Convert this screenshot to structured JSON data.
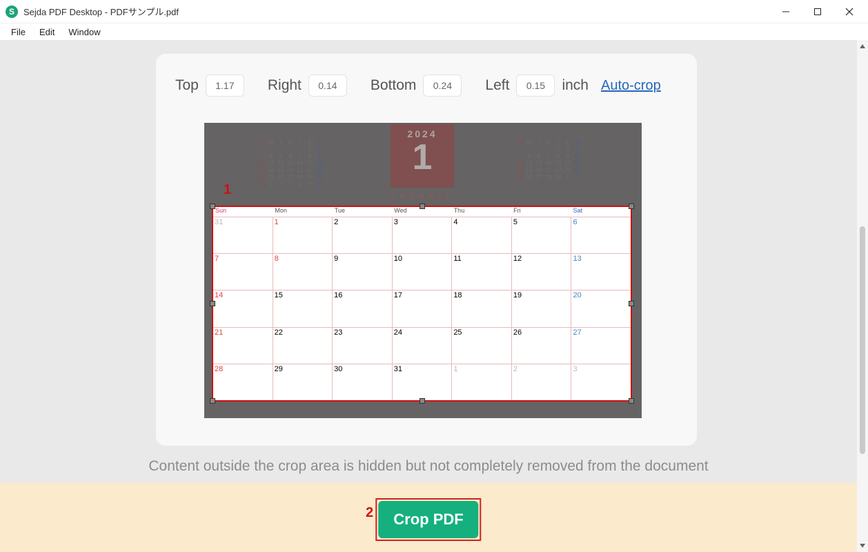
{
  "titlebar": {
    "app_title": "Sejda PDF Desktop - PDFサンプル.pdf"
  },
  "menubar": {
    "file": "File",
    "edit": "Edit",
    "window": "Window"
  },
  "controls": {
    "top_label": "Top",
    "top_value": "1.17",
    "right_label": "Right",
    "right_value": "0.14",
    "bottom_label": "Bottom",
    "bottom_value": "0.24",
    "left_label": "Left",
    "left_value": "0.15",
    "unit_label": "inch",
    "autocrop_label": "Auto-crop"
  },
  "preview": {
    "big_year": "2024",
    "big_month_num": "1",
    "big_month_name": "January",
    "mini_prev": {
      "title": "12",
      "dow": [
        "S",
        "M",
        "T",
        "W",
        "T",
        "F",
        "S"
      ],
      "weeks": [
        [
          "",
          "",
          "",
          "",
          "",
          "1",
          "2"
        ],
        [
          "3",
          "4",
          "5",
          "6",
          "7",
          "8",
          "9"
        ],
        [
          "10",
          "11",
          "12",
          "13",
          "14",
          "15",
          "16"
        ],
        [
          "17",
          "18",
          "19",
          "20",
          "21",
          "22",
          "23"
        ],
        [
          "24",
          "25",
          "26",
          "27",
          "28",
          "29",
          "30"
        ],
        [
          "31",
          "1",
          "2",
          "3",
          "4",
          "5",
          "6"
        ]
      ]
    },
    "mini_next": {
      "title": "2",
      "dow": [
        "S",
        "M",
        "T",
        "W",
        "T",
        "F",
        "S"
      ],
      "weeks": [
        [
          "",
          "",
          "",
          "",
          "1",
          "2",
          "3"
        ],
        [
          "4",
          "5",
          "6",
          "7",
          "8",
          "9",
          "10"
        ],
        [
          "11",
          "12",
          "13",
          "14",
          "15",
          "16",
          "17"
        ],
        [
          "18",
          "19",
          "20",
          "21",
          "22",
          "23",
          "24"
        ],
        [
          "25",
          "26",
          "27",
          "28",
          "29",
          "1",
          "2"
        ]
      ]
    },
    "main_dow": [
      "Sun",
      "Mon",
      "Tue",
      "Wed",
      "Thu",
      "Fri",
      "Sat"
    ],
    "main_weeks": [
      [
        {
          "n": "31",
          "c": "gray"
        },
        {
          "n": "1",
          "c": "sun"
        },
        {
          "n": "2"
        },
        {
          "n": "3"
        },
        {
          "n": "4"
        },
        {
          "n": "5"
        },
        {
          "n": "6",
          "c": "sat"
        }
      ],
      [
        {
          "n": "7",
          "c": "sun"
        },
        {
          "n": "8",
          "c": "sun"
        },
        {
          "n": "9"
        },
        {
          "n": "10"
        },
        {
          "n": "11"
        },
        {
          "n": "12"
        },
        {
          "n": "13",
          "c": "sat"
        }
      ],
      [
        {
          "n": "14",
          "c": "sun"
        },
        {
          "n": "15"
        },
        {
          "n": "16"
        },
        {
          "n": "17"
        },
        {
          "n": "18"
        },
        {
          "n": "19"
        },
        {
          "n": "20",
          "c": "sat"
        }
      ],
      [
        {
          "n": "21",
          "c": "sun"
        },
        {
          "n": "22"
        },
        {
          "n": "23"
        },
        {
          "n": "24"
        },
        {
          "n": "25"
        },
        {
          "n": "26"
        },
        {
          "n": "27",
          "c": "sat"
        }
      ],
      [
        {
          "n": "28",
          "c": "sun"
        },
        {
          "n": "29"
        },
        {
          "n": "30"
        },
        {
          "n": "31"
        },
        {
          "n": "1",
          "c": "gray"
        },
        {
          "n": "2",
          "c": "gray"
        },
        {
          "n": "3",
          "c": "gray"
        }
      ]
    ]
  },
  "helper_text": "Content outside the crop area is hidden but not completely removed from the document",
  "action": {
    "button_label": "Crop PDF"
  },
  "markers": {
    "m1": "1",
    "m2": "2"
  }
}
